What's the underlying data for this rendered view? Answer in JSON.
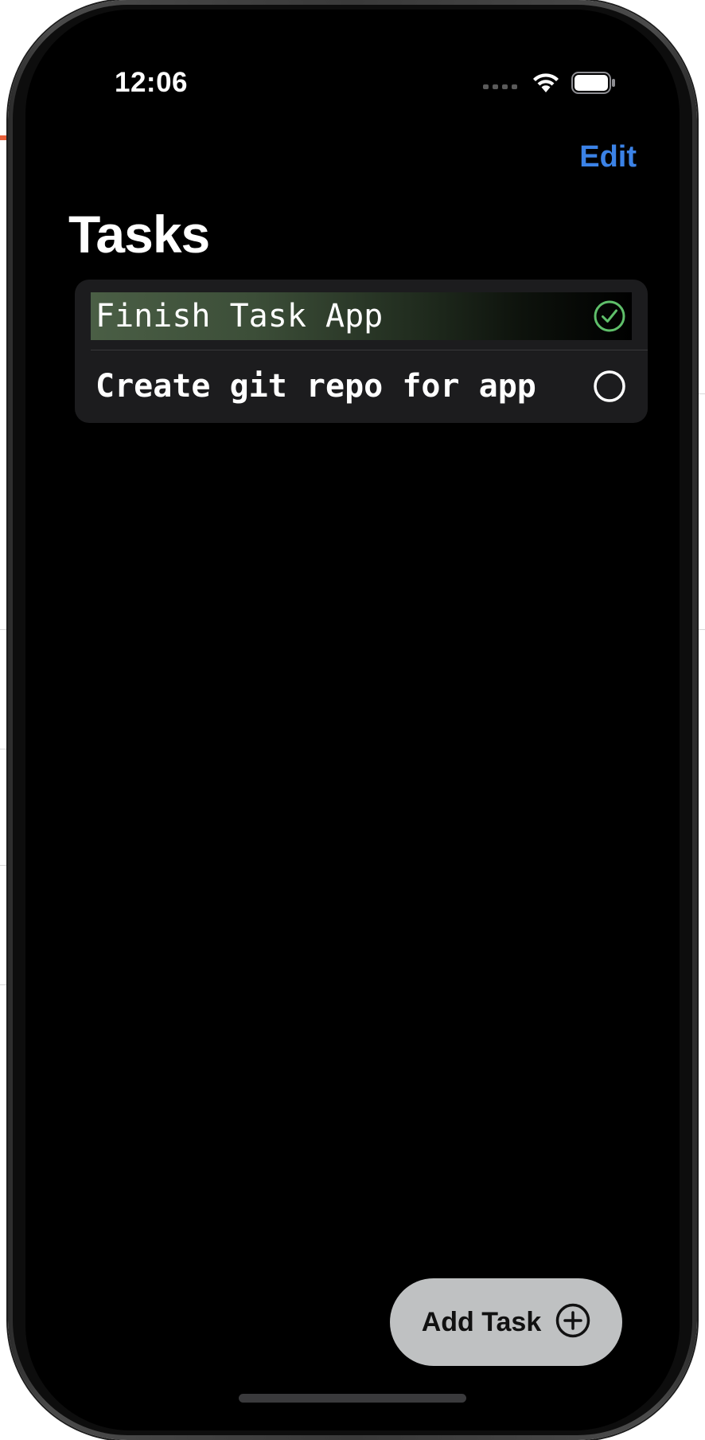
{
  "status_bar": {
    "time": "12:06"
  },
  "nav": {
    "edit_label": "Edit",
    "title": "Tasks"
  },
  "tasks": [
    {
      "label": "Finish Task App",
      "completed": true,
      "icon": "checkmark-circle-icon"
    },
    {
      "label": "Create git repo for app",
      "completed": false,
      "icon": "empty-circle-icon"
    }
  ],
  "add_task": {
    "label": "Add Task",
    "icon": "plus-circle-icon"
  },
  "colors": {
    "accent": "#3b82e6",
    "completed": "#5fbf6a",
    "screen_bg": "#000000",
    "list_bg": "#1c1c1e",
    "button_bg": "#bfc1c2"
  }
}
